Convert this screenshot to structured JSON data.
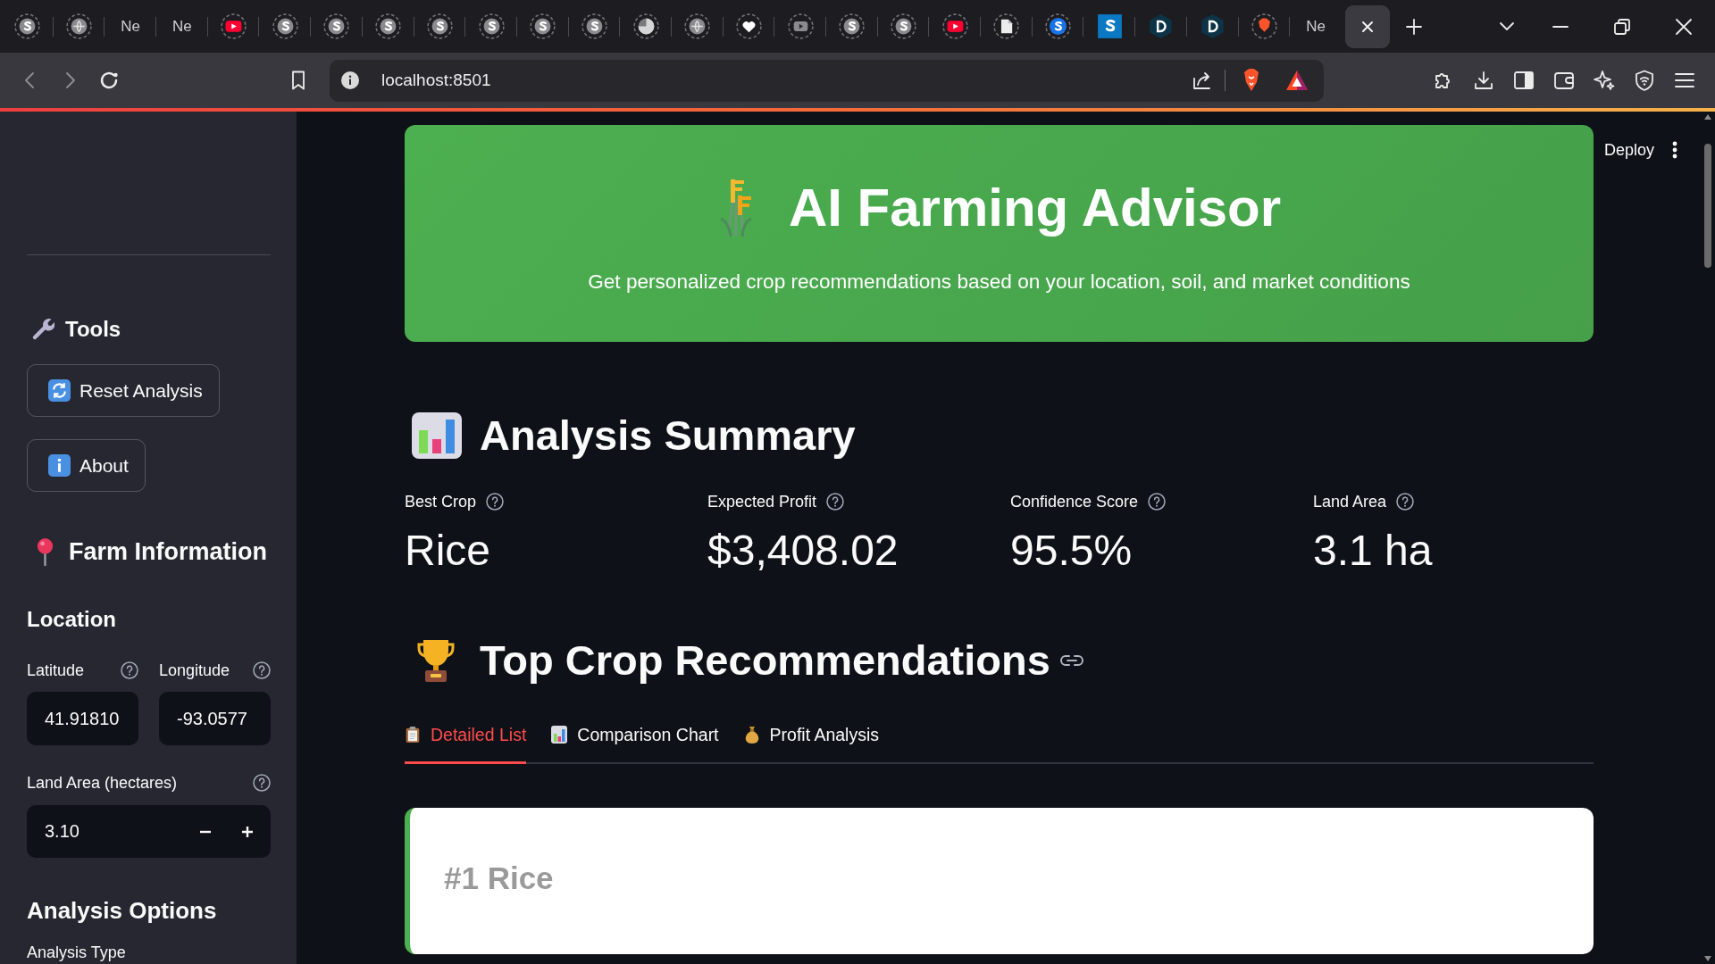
{
  "browser": {
    "tabs": [
      {
        "kind": "sbadge",
        "selected": false
      },
      {
        "kind": "globe",
        "selected": false
      },
      {
        "kind": "title",
        "title": "Ne",
        "selected": false
      },
      {
        "kind": "title",
        "title": "Ne",
        "selected": false
      },
      {
        "kind": "youtube",
        "selected": false
      },
      {
        "kind": "sbadge",
        "selected": false
      },
      {
        "kind": "sbadge",
        "selected": false
      },
      {
        "kind": "sbadge",
        "selected": false
      },
      {
        "kind": "sbadge",
        "selected": false
      },
      {
        "kind": "sbadge",
        "selected": false
      },
      {
        "kind": "sbadge",
        "selected": false
      },
      {
        "kind": "sbadge",
        "selected": false
      },
      {
        "kind": "moon",
        "selected": false
      },
      {
        "kind": "globe",
        "selected": false
      },
      {
        "kind": "heart",
        "selected": false
      },
      {
        "kind": "play",
        "selected": false
      },
      {
        "kind": "sbadge",
        "selected": false
      },
      {
        "kind": "sbadge",
        "selected": false
      },
      {
        "kind": "youtube",
        "selected": false
      },
      {
        "kind": "page",
        "selected": false
      },
      {
        "kind": "sblue",
        "selected": false
      },
      {
        "kind": "ssquare",
        "selected": false
      },
      {
        "kind": "dhex",
        "selected": false
      },
      {
        "kind": "dhex",
        "selected": false
      },
      {
        "kind": "brave",
        "selected": false
      },
      {
        "kind": "title",
        "title": "Ne",
        "selected": false
      },
      {
        "kind": "close",
        "selected": true
      }
    ],
    "address": "localhost:8501"
  },
  "header": {
    "deploy": "Deploy"
  },
  "sidebar": {
    "tools_heading": "Tools",
    "buttons": [
      {
        "kind": "reset",
        "label": "Reset Analysis"
      },
      {
        "kind": "info",
        "label": "About"
      }
    ],
    "farm_heading": "Farm Information",
    "location_heading": "Location",
    "coordinates": [
      {
        "label": "Latitude",
        "value": "41.91810"
      },
      {
        "label": "Longitude",
        "value": "-93.0577"
      }
    ],
    "land_area": {
      "label": "Land Area (hectares)",
      "value": "3.10"
    },
    "options_heading": "Analysis Options",
    "analysis_type_label": "Analysis Type"
  },
  "banner": {
    "title": "AI Farming Advisor",
    "subtitle": "Get personalized crop recommendations based on your location, soil, and market conditions"
  },
  "summary": {
    "heading": "Analysis Summary",
    "metrics": [
      {
        "label": "Best Crop",
        "value": "Rice"
      },
      {
        "label": "Expected Profit",
        "value": "$3,408.02"
      },
      {
        "label": "Confidence Score",
        "value": "95.5%"
      },
      {
        "label": "Land Area",
        "value": "3.1 ha"
      }
    ]
  },
  "recommendations": {
    "heading": "Top Crop Recommendations",
    "tabs": [
      {
        "kind": "clipboard",
        "label": "Detailed List",
        "selected": true
      },
      {
        "kind": "chart",
        "label": "Comparison Chart",
        "selected": false
      },
      {
        "kind": "moneybag",
        "label": "Profit Analysis",
        "selected": false
      }
    ],
    "card": {
      "title": "#1 Rice"
    }
  }
}
